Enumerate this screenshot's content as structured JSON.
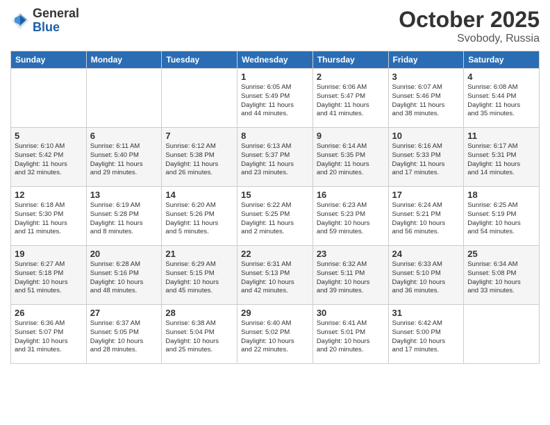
{
  "header": {
    "logo_general": "General",
    "logo_blue": "Blue",
    "month": "October 2025",
    "location": "Svobody, Russia"
  },
  "days_of_week": [
    "Sunday",
    "Monday",
    "Tuesday",
    "Wednesday",
    "Thursday",
    "Friday",
    "Saturday"
  ],
  "weeks": [
    [
      {
        "day": "",
        "info": ""
      },
      {
        "day": "",
        "info": ""
      },
      {
        "day": "",
        "info": ""
      },
      {
        "day": "1",
        "info": "Sunrise: 6:05 AM\nSunset: 5:49 PM\nDaylight: 11 hours\nand 44 minutes."
      },
      {
        "day": "2",
        "info": "Sunrise: 6:06 AM\nSunset: 5:47 PM\nDaylight: 11 hours\nand 41 minutes."
      },
      {
        "day": "3",
        "info": "Sunrise: 6:07 AM\nSunset: 5:46 PM\nDaylight: 11 hours\nand 38 minutes."
      },
      {
        "day": "4",
        "info": "Sunrise: 6:08 AM\nSunset: 5:44 PM\nDaylight: 11 hours\nand 35 minutes."
      }
    ],
    [
      {
        "day": "5",
        "info": "Sunrise: 6:10 AM\nSunset: 5:42 PM\nDaylight: 11 hours\nand 32 minutes."
      },
      {
        "day": "6",
        "info": "Sunrise: 6:11 AM\nSunset: 5:40 PM\nDaylight: 11 hours\nand 29 minutes."
      },
      {
        "day": "7",
        "info": "Sunrise: 6:12 AM\nSunset: 5:38 PM\nDaylight: 11 hours\nand 26 minutes."
      },
      {
        "day": "8",
        "info": "Sunrise: 6:13 AM\nSunset: 5:37 PM\nDaylight: 11 hours\nand 23 minutes."
      },
      {
        "day": "9",
        "info": "Sunrise: 6:14 AM\nSunset: 5:35 PM\nDaylight: 11 hours\nand 20 minutes."
      },
      {
        "day": "10",
        "info": "Sunrise: 6:16 AM\nSunset: 5:33 PM\nDaylight: 11 hours\nand 17 minutes."
      },
      {
        "day": "11",
        "info": "Sunrise: 6:17 AM\nSunset: 5:31 PM\nDaylight: 11 hours\nand 14 minutes."
      }
    ],
    [
      {
        "day": "12",
        "info": "Sunrise: 6:18 AM\nSunset: 5:30 PM\nDaylight: 11 hours\nand 11 minutes."
      },
      {
        "day": "13",
        "info": "Sunrise: 6:19 AM\nSunset: 5:28 PM\nDaylight: 11 hours\nand 8 minutes."
      },
      {
        "day": "14",
        "info": "Sunrise: 6:20 AM\nSunset: 5:26 PM\nDaylight: 11 hours\nand 5 minutes."
      },
      {
        "day": "15",
        "info": "Sunrise: 6:22 AM\nSunset: 5:25 PM\nDaylight: 11 hours\nand 2 minutes."
      },
      {
        "day": "16",
        "info": "Sunrise: 6:23 AM\nSunset: 5:23 PM\nDaylight: 10 hours\nand 59 minutes."
      },
      {
        "day": "17",
        "info": "Sunrise: 6:24 AM\nSunset: 5:21 PM\nDaylight: 10 hours\nand 56 minutes."
      },
      {
        "day": "18",
        "info": "Sunrise: 6:25 AM\nSunset: 5:19 PM\nDaylight: 10 hours\nand 54 minutes."
      }
    ],
    [
      {
        "day": "19",
        "info": "Sunrise: 6:27 AM\nSunset: 5:18 PM\nDaylight: 10 hours\nand 51 minutes."
      },
      {
        "day": "20",
        "info": "Sunrise: 6:28 AM\nSunset: 5:16 PM\nDaylight: 10 hours\nand 48 minutes."
      },
      {
        "day": "21",
        "info": "Sunrise: 6:29 AM\nSunset: 5:15 PM\nDaylight: 10 hours\nand 45 minutes."
      },
      {
        "day": "22",
        "info": "Sunrise: 6:31 AM\nSunset: 5:13 PM\nDaylight: 10 hours\nand 42 minutes."
      },
      {
        "day": "23",
        "info": "Sunrise: 6:32 AM\nSunset: 5:11 PM\nDaylight: 10 hours\nand 39 minutes."
      },
      {
        "day": "24",
        "info": "Sunrise: 6:33 AM\nSunset: 5:10 PM\nDaylight: 10 hours\nand 36 minutes."
      },
      {
        "day": "25",
        "info": "Sunrise: 6:34 AM\nSunset: 5:08 PM\nDaylight: 10 hours\nand 33 minutes."
      }
    ],
    [
      {
        "day": "26",
        "info": "Sunrise: 6:36 AM\nSunset: 5:07 PM\nDaylight: 10 hours\nand 31 minutes."
      },
      {
        "day": "27",
        "info": "Sunrise: 6:37 AM\nSunset: 5:05 PM\nDaylight: 10 hours\nand 28 minutes."
      },
      {
        "day": "28",
        "info": "Sunrise: 6:38 AM\nSunset: 5:04 PM\nDaylight: 10 hours\nand 25 minutes."
      },
      {
        "day": "29",
        "info": "Sunrise: 6:40 AM\nSunset: 5:02 PM\nDaylight: 10 hours\nand 22 minutes."
      },
      {
        "day": "30",
        "info": "Sunrise: 6:41 AM\nSunset: 5:01 PM\nDaylight: 10 hours\nand 20 minutes."
      },
      {
        "day": "31",
        "info": "Sunrise: 6:42 AM\nSunset: 5:00 PM\nDaylight: 10 hours\nand 17 minutes."
      },
      {
        "day": "",
        "info": ""
      }
    ]
  ]
}
